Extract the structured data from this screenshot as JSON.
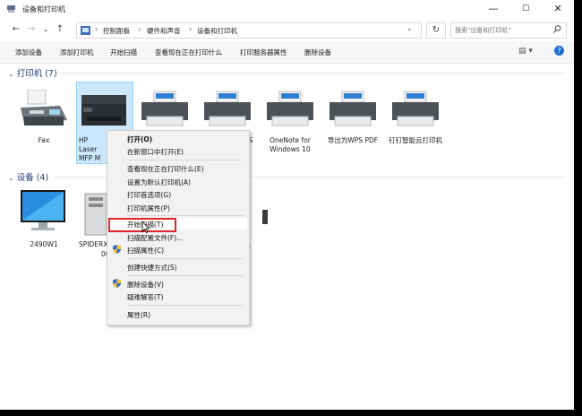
{
  "window": {
    "title": "设备和打印机"
  },
  "window_controls": {
    "minimize": "—",
    "maximize": "☐",
    "close": "✕"
  },
  "nav": {
    "back": "←",
    "forward": "→",
    "dropdown": "⌄",
    "up": "↑",
    "refresh": "↻",
    "chevron": "⌄"
  },
  "address": {
    "crumbs": [
      "控制面板",
      "硬件和声音",
      "设备和打印机"
    ],
    "separator": "›"
  },
  "search": {
    "placeholder": "搜索\"设备和打印机\""
  },
  "toolbar": {
    "items": [
      "添加设备",
      "添加打印机",
      "开始扫描",
      "查看现在正在打印什么",
      "打印服务器属性",
      "删除设备"
    ],
    "view_icon": "▤ ▾",
    "help": "?"
  },
  "printers_group": {
    "label": "打印机 (7)",
    "chevron": "⌄"
  },
  "printers": [
    {
      "label": "Fax"
    },
    {
      "label": "HP Laser MFP M"
    },
    {
      "label": ""
    },
    {
      "label": "S"
    },
    {
      "label": "OneNote for Windows 10"
    },
    {
      "label": "导出为WPS PDF"
    },
    {
      "label": "钉钉智能云打印机"
    }
  ],
  "devices_group": {
    "label": "设备 (4)",
    "chevron": "⌄"
  },
  "devices": [
    {
      "label": "2490W1"
    },
    {
      "label": "SPIDERX"
    },
    {
      "label": "00"
    },
    {
      "label": "L"
    }
  ],
  "context_menu": {
    "items": [
      {
        "label": "打开(O)",
        "bold": true
      },
      {
        "label": "在新窗口中打开(E)"
      },
      {
        "label": "查看现在正在打印什么(E)"
      },
      {
        "label": "设置为默认打印机(A)"
      },
      {
        "label": "打印首选项(G)"
      },
      {
        "label": "打印机属性(P)"
      },
      {
        "label": "开始扫描(T)"
      },
      {
        "label": "扫描配置文件(F)..."
      },
      {
        "label": "扫描属性(C)"
      },
      {
        "label": "创建快捷方式(S)"
      },
      {
        "label": "删除设备(V)"
      },
      {
        "label": "疑难解答(T)"
      },
      {
        "label": "属性(R)"
      }
    ]
  },
  "colors": {
    "accent": "#1f6fd1",
    "selection": "#cce8ff",
    "highlight_box": "#e0262a",
    "group_header": "#1e3c78"
  }
}
